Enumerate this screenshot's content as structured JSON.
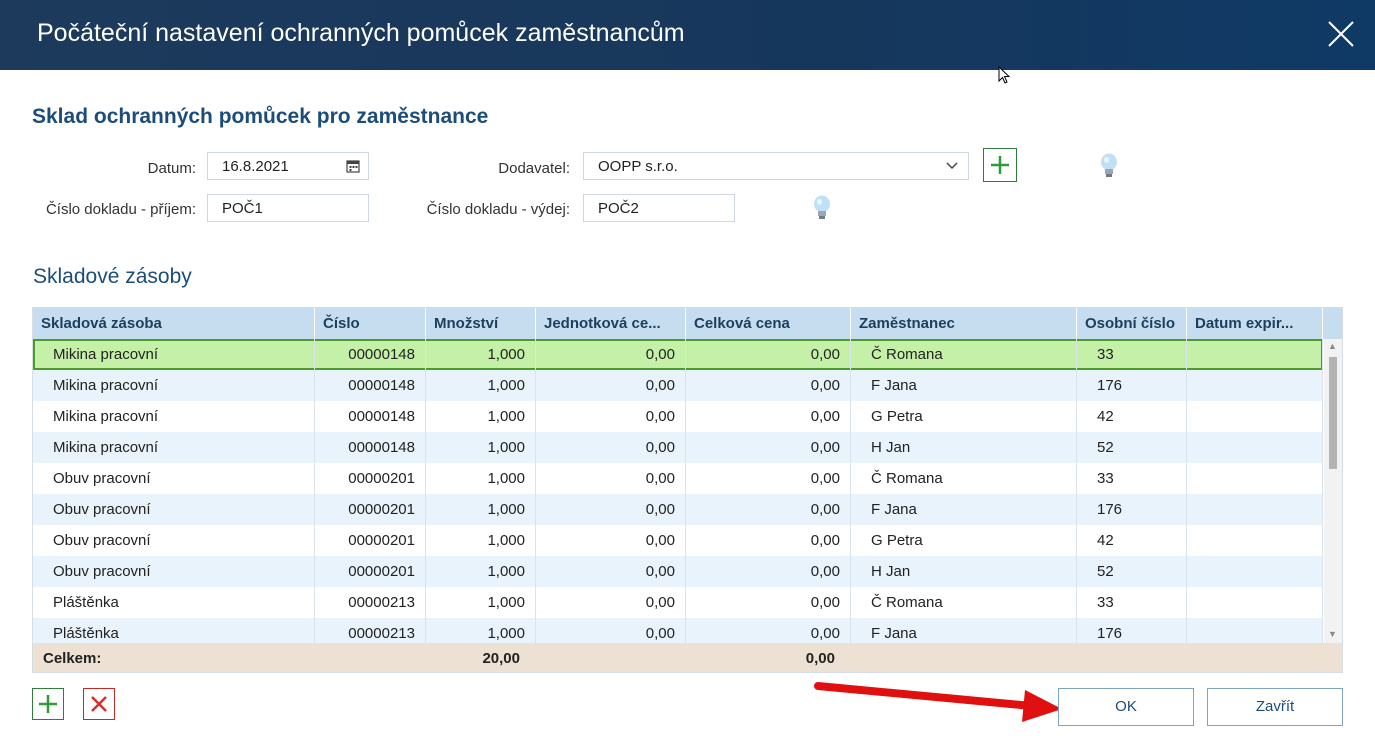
{
  "window": {
    "title": "Počáteční nastavení ochranných pomůcek zaměstnancům"
  },
  "section": {
    "title": "Sklad ochranných pomůcek pro zaměstnance"
  },
  "form": {
    "date_label": "Datum:",
    "date_value": "16.8.2021",
    "supplier_label": "Dodavatel:",
    "supplier_value": "OOPP s.r.o.",
    "receipt_label": "Číslo dokladu - příjem:",
    "receipt_value": "POČ1",
    "issue_label": "Číslo dokladu - výdej:",
    "issue_value": "POČ2"
  },
  "grid": {
    "title": "Skladové zásoby",
    "columns": [
      "Skladová zásoba",
      "Číslo",
      "Množství",
      "Jednotková ce...",
      "Celková cena",
      "Zaměstnanec",
      "Osobní číslo",
      "Datum expir..."
    ],
    "rows": [
      [
        "Mikina pracovní",
        "00000148",
        "1,000",
        "0,00",
        "0,00",
        "Č Romana",
        "33",
        ""
      ],
      [
        "Mikina pracovní",
        "00000148",
        "1,000",
        "0,00",
        "0,00",
        "F Jana",
        "176",
        ""
      ],
      [
        "Mikina pracovní",
        "00000148",
        "1,000",
        "0,00",
        "0,00",
        "G Petra",
        "42",
        ""
      ],
      [
        "Mikina pracovní",
        "00000148",
        "1,000",
        "0,00",
        "0,00",
        "H Jan",
        "52",
        ""
      ],
      [
        "Obuv pracovní",
        "00000201",
        "1,000",
        "0,00",
        "0,00",
        "Č Romana",
        "33",
        ""
      ],
      [
        "Obuv pracovní",
        "00000201",
        "1,000",
        "0,00",
        "0,00",
        "F Jana",
        "176",
        ""
      ],
      [
        "Obuv pracovní",
        "00000201",
        "1,000",
        "0,00",
        "0,00",
        "G Petra",
        "42",
        ""
      ],
      [
        "Obuv pracovní",
        "00000201",
        "1,000",
        "0,00",
        "0,00",
        "H Jan",
        "52",
        ""
      ],
      [
        "Pláštěnka",
        "00000213",
        "1,000",
        "0,00",
        "0,00",
        "Č Romana",
        "33",
        ""
      ],
      [
        "Pláštěnka",
        "00000213",
        "1,000",
        "0,00",
        "0,00",
        "F Jana",
        "176",
        ""
      ]
    ],
    "selected_row": 0,
    "footer": {
      "label": "Celkem:",
      "total_quantity": "20,00",
      "total_price": "0,00"
    }
  },
  "buttons": {
    "ok": "OK",
    "close": "Zavřít"
  },
  "colors": {
    "titlebar": "#16375c",
    "selected_row": "#c5f0a7",
    "header": "#c5ddef",
    "footer": "#ede1d4",
    "arrow": "#e01010",
    "add": "#2e9a3a",
    "delete": "#d32f2f"
  },
  "icons": [
    "close-icon",
    "calendar-icon",
    "chevron-down-icon",
    "plus-icon",
    "lightbulb-icon",
    "delete-icon",
    "cursor-icon",
    "arrow-icon"
  ]
}
